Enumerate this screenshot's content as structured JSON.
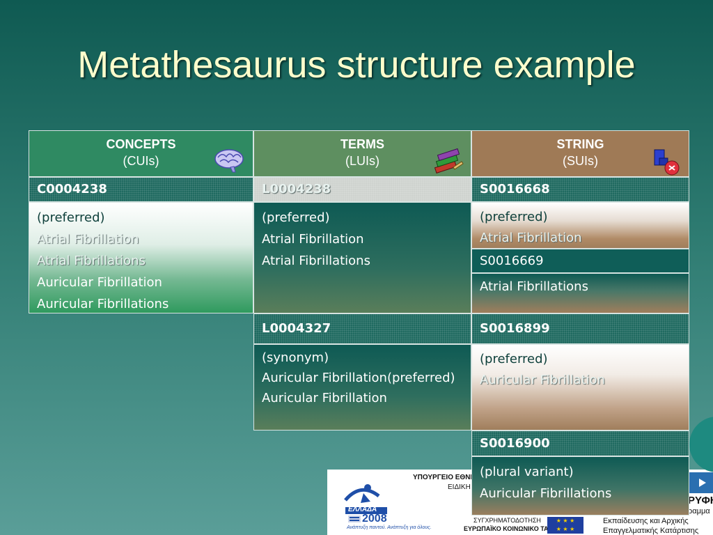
{
  "title": "Metathesaurus structure example",
  "headers": {
    "concepts": {
      "label": "CONCEPTS",
      "sub": "(CUIs)",
      "icon": "brain-icon"
    },
    "terms": {
      "label": "TERMS",
      "sub": "(LUIs)",
      "icon": "books-icon"
    },
    "strings": {
      "label": "STRING",
      "sub": "(SUIs)",
      "icon": "string-blocks-icon"
    }
  },
  "concept": {
    "id": "C0004238",
    "lines": [
      "(preferred)",
      "Atrial Fibrillation",
      "Atrial Fibrillations",
      "Auricular Fibrillation",
      "Auricular Fibrillations"
    ]
  },
  "terms": [
    {
      "id": "L0004238",
      "lines": [
        "(preferred)",
        "Atrial Fibrillation",
        "Atrial Fibrillations"
      ]
    },
    {
      "id": "L0004327",
      "lines": [
        "(synonym)",
        "Auricular Fibrillation(preferred)",
        "Auricular Fibrillation"
      ]
    }
  ],
  "strings": [
    {
      "id": "S0016668",
      "lines": [
        "(preferred)",
        "Atrial Fibrillation"
      ]
    },
    {
      "id": "S0016669",
      "lines": [
        "Atrial Fibrillations"
      ]
    },
    {
      "id": "S0016899",
      "lines": [
        "(preferred)",
        "Auricular Fibrillation"
      ]
    },
    {
      "id": "S0016900",
      "lines": [
        "(plural variant)",
        "Auricular Fibrillations"
      ]
    }
  ],
  "footer": {
    "ministry_line1": "ΥΠΟΥΡΓΕΙΟ ΕΘΝΙΚΗΣ Π",
    "ministry_line2": "ΕΙΔΙΚΗ ΥΓ",
    "logo_text": "ΕΛΛΑΔΑ",
    "logo_year": "2008",
    "logo_slogan": "Ανάπτυξη παντού. Ανάπτυξη για όλους.",
    "cofund_line1": "ΣΥΓΧΡΗΜΑΤΟΔΟΤΗΣΗ",
    "cofund_line2": "ΕΥΡΩΠΑΪΚΟ ΚΟΙΝΩΝΙΚΟ ΤΑΜΕΙΟ",
    "program_right1": "ΡΥΦΗ",
    "program_right2": "ραμμα",
    "program_line1": "Εκπαίδευσης και Αρχικής",
    "program_line2": "Επαγγελματικής Κατάρτισης"
  }
}
